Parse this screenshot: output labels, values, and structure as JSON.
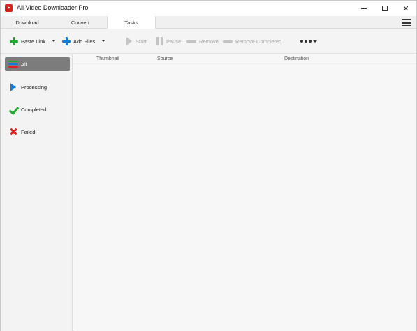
{
  "window": {
    "title": "All Video Downloader Pro"
  },
  "tabs": [
    {
      "label": "Download",
      "active": false
    },
    {
      "label": "Convert",
      "active": false
    },
    {
      "label": "Tasks",
      "active": true
    }
  ],
  "toolbar": {
    "paste_link_label": "Paste Link",
    "add_files_label": "Add Files",
    "start_label": "Start",
    "pause_label": "Pause",
    "remove_label": "Remove",
    "remove_completed_label": "Remove Completed"
  },
  "sidebar": {
    "items": [
      {
        "label": "All",
        "selected": true,
        "icon": "list-colored-icon"
      },
      {
        "label": "Processing",
        "selected": false,
        "icon": "play-icon"
      },
      {
        "label": "Completed",
        "selected": false,
        "icon": "check-icon"
      },
      {
        "label": "Failed",
        "selected": false,
        "icon": "x-icon"
      }
    ]
  },
  "task_list": {
    "columns": [
      "Thumbnail",
      "Source",
      "Destination"
    ],
    "rows": []
  },
  "colors": {
    "accent_green": "#1faa2e",
    "accent_blue": "#1479d9",
    "error_red": "#e02020",
    "app_icon_red": "#d9221c",
    "selected_sidebar": "#7c7c7c"
  }
}
